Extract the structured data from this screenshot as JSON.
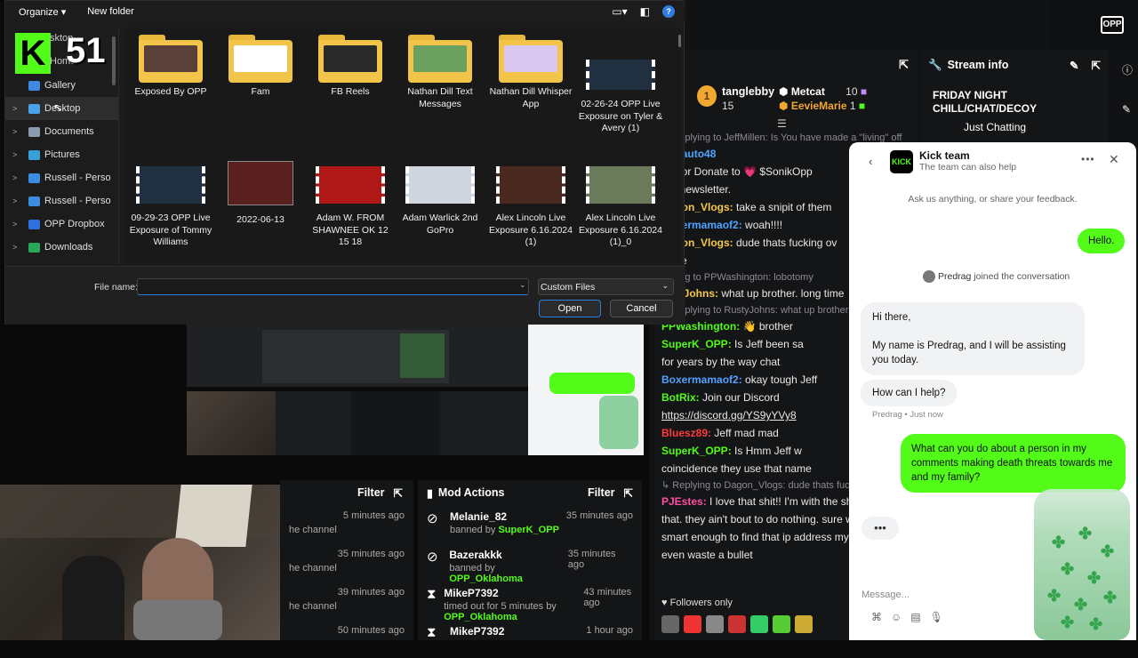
{
  "dialog": {
    "toolbar": {
      "organize": "Organize ▾",
      "new_folder": "New folder"
    },
    "nav": [
      {
        "label": "Gallery",
        "color": "#3d8ae0",
        "chev": ""
      },
      {
        "label": "Desktop",
        "color": "#4aa3e8",
        "chev": ">"
      },
      {
        "label": "Documents",
        "color": "#8c9bb0",
        "chev": ">"
      },
      {
        "label": "Pictures",
        "color": "#3aa0d8",
        "chev": ">"
      },
      {
        "label": "Russell - Perso",
        "color": "#3a8de0",
        "chev": ">"
      },
      {
        "label": "Russell - Perso",
        "color": "#3a8de0",
        "chev": ">"
      },
      {
        "label": "OPP Dropbox",
        "color": "#2f6fe0",
        "chev": ">"
      },
      {
        "label": "Downloads",
        "color": "#2aa85a",
        "chev": ">"
      }
    ],
    "nav_partial": {
      "home_top": "sktop",
      "home": "Home"
    },
    "files": [
      {
        "name": "Exposed By OPP",
        "kind": "folder"
      },
      {
        "name": "Fam",
        "kind": "folder"
      },
      {
        "name": "FB Reels",
        "kind": "folder"
      },
      {
        "name": "Nathan Dill Text Messages",
        "kind": "folder"
      },
      {
        "name": "Nathan Dill Whisper App",
        "kind": "folder"
      },
      {
        "name": "02-26-24 OPP Live Exposure on Tyler & Avery (1)",
        "kind": "video"
      },
      {
        "name": "09-29-23 OPP Live Exposure of Tommy Williams",
        "kind": "video"
      },
      {
        "name": "2022-06-13",
        "kind": "image"
      },
      {
        "name": "Adam W. FROM SHAWNEE OK 12 15 18",
        "kind": "video"
      },
      {
        "name": "Adam Warlick 2nd GoPro",
        "kind": "video"
      },
      {
        "name": "Alex Lincoln Live Exposure 6.16.2024 (1)",
        "kind": "video"
      },
      {
        "name": "Alex Lincoln Live Exposure 6.16.2024 (1)_0",
        "kind": "video"
      }
    ],
    "file_name_label": "File name:",
    "file_name_value": "",
    "file_type": "Custom Files",
    "open": "Open",
    "cancel": "Cancel"
  },
  "overlay": {
    "badge_number": "51",
    "badge_letter": "K"
  },
  "chat": {
    "header_partial": "t",
    "leaderboard": [
      {
        "rank": "1",
        "name": "tanglebby",
        "count": "15"
      },
      {
        "name": "Metcat",
        "count": "10"
      },
      {
        "name": "EevieMarie",
        "count": "1"
      }
    ],
    "lines": [
      {
        "type": "reply",
        "text": "Replying to JeffMillen: Is You have made a \"living\" off"
      },
      {
        "type": "msg",
        "user": "auto48",
        "ucolor": "#4fa3ff",
        "text": "",
        "prefix": "t by"
      },
      {
        "type": "msg",
        "user": "",
        "ucolor": "#fff",
        "text": "sub or Donate to 💗 $SonikOpp"
      },
      {
        "type": "msg",
        "user": "",
        "ucolor": "#fff",
        "text": "our newsletter."
      },
      {
        "type": "msg",
        "user": "Dagon_Vlogs:",
        "ucolor": "#f7c948",
        "text": " take a snipit of them"
      },
      {
        "type": "msg",
        "user": "Boxermamaof2:",
        "ucolor": "#4fa3ff",
        "text": " woah!!!!"
      },
      {
        "type": "msg",
        "user": "Dagon_Vlogs:",
        "ucolor": "#f7c948",
        "text": " dude thats fucking ov"
      },
      {
        "type": "msg",
        "user": "",
        "ucolor": "#fff",
        "text": "g line"
      },
      {
        "type": "reply",
        "text": "ying to PPWashington: lobotomy"
      },
      {
        "type": "msg",
        "user": "ustyJohns:",
        "ucolor": "#f7c948",
        "text": " what up brother. long time"
      },
      {
        "type": "reply",
        "text": "Replying to RustyJohns: what up brother. lo"
      },
      {
        "type": "msg",
        "user": "PPWashington:",
        "ucolor": "#53fc18",
        "text": " 👋 brother"
      },
      {
        "type": "msg",
        "user": "SuperK_OPP:",
        "ucolor": "#53fc18",
        "text": " Is Jeff been sa"
      },
      {
        "type": "msg",
        "user": "",
        "ucolor": "#fff",
        "text": "for years by the way chat"
      },
      {
        "type": "msg",
        "user": "Boxermamaof2:",
        "ucolor": "#4fa3ff",
        "text": " okay tough Jeff"
      },
      {
        "type": "msg",
        "user": "BotRix:",
        "ucolor": "#53fc18",
        "text": " Join our Discord"
      },
      {
        "type": "link",
        "text": "https://discord.gg/YS9yYVy8"
      },
      {
        "type": "msg",
        "user": "Bluesz89:",
        "ucolor": "#ff3b3b",
        "text": " Jeff mad mad"
      },
      {
        "type": "msg",
        "user": "SuperK_OPP:",
        "ucolor": "#53fc18",
        "text": " Is Hmm Jeff w"
      },
      {
        "type": "msg",
        "user": "",
        "ucolor": "#fff",
        "text": "coincidence they use that name"
      },
      {
        "type": "reply",
        "text": "Replying to Dagon_Vlogs: dude thats fuckin"
      },
      {
        "type": "msg",
        "user": "PJEstes:",
        "ucolor": "#ff4fa0",
        "text": " I love that shit!! I'm with the sh"
      },
      {
        "type": "msg",
        "user": "",
        "ucolor": "#fff",
        "text": "that. they ain't bout to do nothing. sure wi"
      },
      {
        "type": "msg",
        "user": "",
        "ucolor": "#fff",
        "text": "smart enough to find that ip address mysel"
      },
      {
        "type": "msg",
        "user": "",
        "ucolor": "#fff",
        "text": "even waste a bullet"
      }
    ],
    "followers_only": "Followers only"
  },
  "stream_info": {
    "header": "Stream info",
    "title": "FRIDAY NIGHT CHILL/CHAT/DECOY",
    "category": "Just Chatting"
  },
  "mod_left": {
    "filter": "Filter",
    "rows": [
      {
        "time": "5 minutes ago",
        "text": "he channel"
      },
      {
        "time": "35 minutes ago",
        "text": "he channel"
      },
      {
        "time": "39 minutes ago",
        "text": "he channel"
      },
      {
        "time": "50 minutes ago",
        "text": ""
      }
    ]
  },
  "mod_actions": {
    "title": "Mod Actions",
    "filter": "Filter",
    "rows": [
      {
        "icon": "ban-icon",
        "who": "Melanie_82",
        "action": "banned by ",
        "by": "SuperK_OPP",
        "time": "35 minutes ago"
      },
      {
        "icon": "ban-icon",
        "who": "Bazerakkk",
        "action": "banned by ",
        "by": "OPP_Oklahoma",
        "time": "35 minutes ago"
      },
      {
        "icon": "hourglass-icon",
        "who": "MikeP7392",
        "action": "timed out for 5 minutes by ",
        "by": "OPP_Oklahoma",
        "time": "43 minutes ago"
      },
      {
        "icon": "hourglass-icon",
        "who": "MikeP7392",
        "action": "",
        "by": "",
        "time": "1 hour ago"
      }
    ]
  },
  "kick": {
    "title": "Kick team",
    "subtitle": "The team can also help",
    "prompt": "Ask us anything, or share your feedback.",
    "user_hello": "Hello.",
    "joined_name": "Predrag",
    "joined_text": " joined the conversation",
    "agent_msg_1a": "Hi there,",
    "agent_msg_1b": "My name is Predrag, and I will be assisting you today.",
    "agent_msg_2": "How can I help?",
    "agent_meta": "Predrag • Just now",
    "user_msg": "What can you do about a person in my comments making death threats towards me and my family?",
    "typing": "•••",
    "input_placeholder": "Message..."
  },
  "colors": {
    "kick_green": "#53fc18",
    "dialog_bg": "#1c1c1c",
    "accent_blue": "#0078d4"
  }
}
